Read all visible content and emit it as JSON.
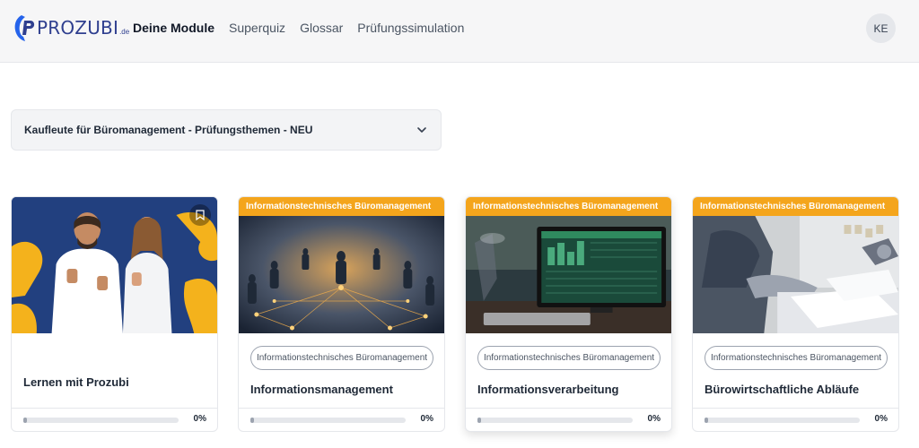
{
  "header": {
    "logo_text": "PROZUBI",
    "logo_tld": ".de",
    "nav": [
      {
        "label": "Deine Module",
        "active": true
      },
      {
        "label": "Superquiz",
        "active": false
      },
      {
        "label": "Glossar",
        "active": false
      },
      {
        "label": "Prüfungssimulation",
        "active": false
      }
    ],
    "avatar_initials": "KE"
  },
  "course_select": {
    "value": "Kaufleute für Büromanagement - Prüfungsthemen - NEU"
  },
  "cards": [
    {
      "banner": "",
      "tag": "",
      "title": "Lernen mit Prozubi",
      "progress": 0,
      "progress_label": "0%",
      "image": "photo-two-people-thumbs-up"
    },
    {
      "banner": "Informationstechnisches Büromanagement",
      "tag": "Informationstechnisches Büromanagement",
      "title": "Informationsmanagement",
      "progress": 0,
      "progress_label": "0%",
      "image": "photo-network-people"
    },
    {
      "banner": "Informationstechnisches Büromanagement",
      "tag": "Informationstechnisches Büromanagement",
      "title": "Informationsverarbeitung",
      "progress": 0,
      "progress_label": "0%",
      "image": "photo-spreadsheet-monitor"
    },
    {
      "banner": "Informationstechnisches Büromanagement",
      "tag": "Informationstechnisches Büromanagement",
      "title": "Bürowirtschaftliche Abläufe",
      "progress": 0,
      "progress_label": "0%",
      "image": "photo-office-paperwork"
    }
  ],
  "colors": {
    "accent": "#f4a51c",
    "brand": "#2f3f8f",
    "brand_light": "#2563eb"
  }
}
